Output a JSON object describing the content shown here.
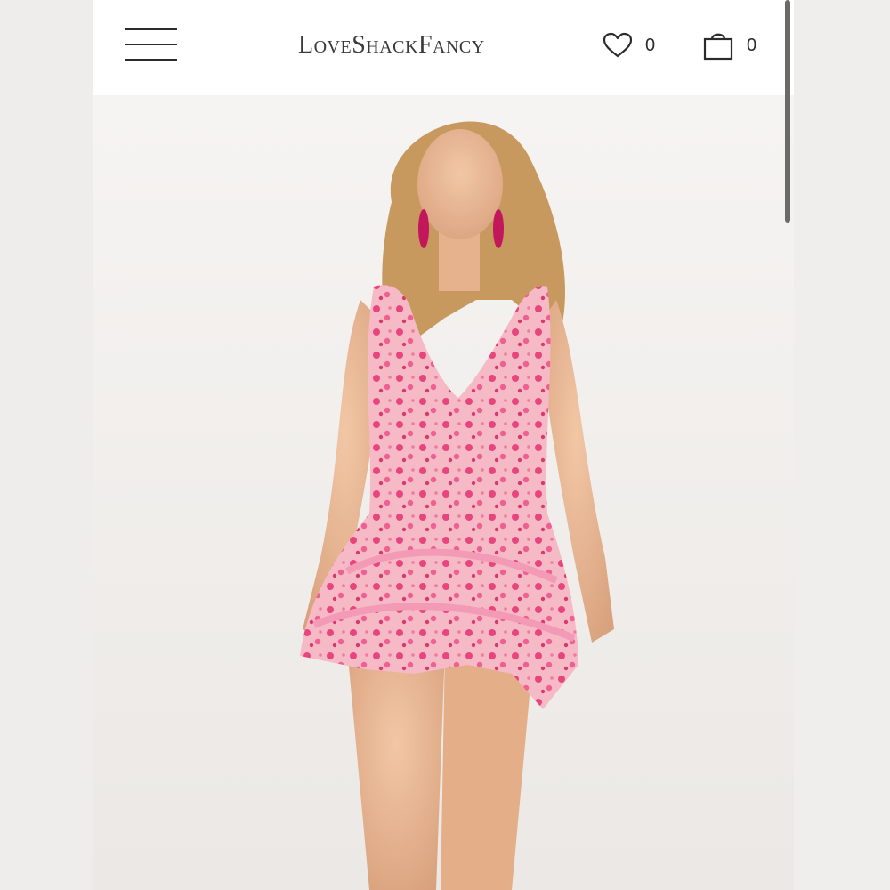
{
  "header": {
    "menu_icon": "hamburger-menu-icon",
    "logo_text": "LoveShackFancy",
    "wishlist": {
      "icon": "heart-icon",
      "count": "0"
    },
    "cart": {
      "icon": "shopping-bag-icon",
      "count": "0"
    }
  },
  "colors": {
    "header_bg": "#ffffff",
    "page_bg": "#f4f2f0",
    "text": "#2b2b2b",
    "dress_pink": "#f08aa8"
  }
}
